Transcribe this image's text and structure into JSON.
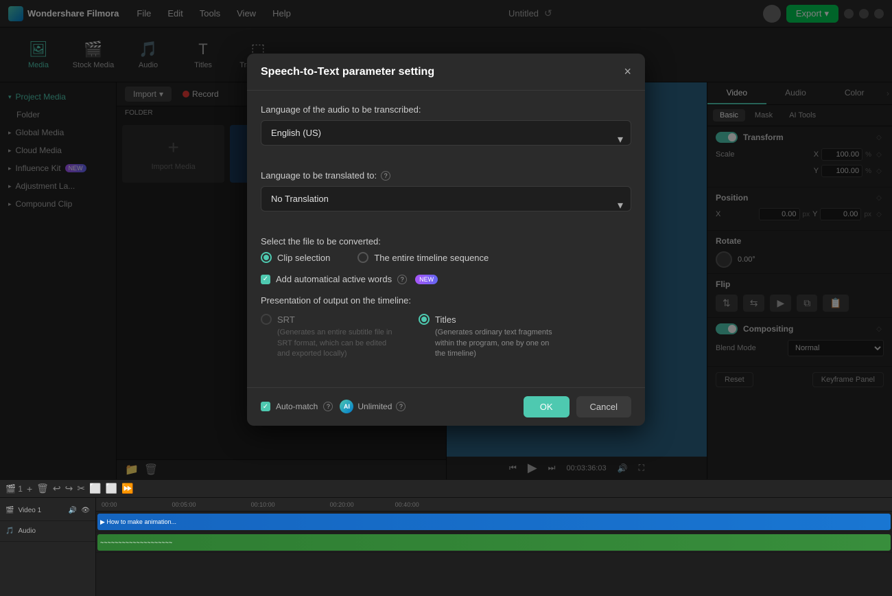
{
  "app": {
    "name": "Wondershare Filmora",
    "title": "Untitled"
  },
  "menu": [
    "File",
    "Edit",
    "Tools",
    "View",
    "Help"
  ],
  "toolbar": {
    "tabs": [
      "Media",
      "Stock Media",
      "Audio",
      "Titles",
      "Transitions"
    ]
  },
  "export_btn": "Export",
  "sidebar": {
    "items": [
      {
        "label": "Project Media",
        "active": true
      },
      {
        "label": "Folder"
      },
      {
        "label": "Global Media"
      },
      {
        "label": "Cloud Media"
      },
      {
        "label": "Influence Kit",
        "badge": "NEW"
      },
      {
        "label": "Adjustment La..."
      },
      {
        "label": "Compound Clip"
      }
    ]
  },
  "media_toolbar": {
    "import_label": "Import",
    "record_label": "Record"
  },
  "folder_label": "FOLDER",
  "right_panel": {
    "tabs": [
      "Video",
      "Audio",
      "Color"
    ],
    "subtabs": [
      "Basic",
      "Mask",
      "AI Tools"
    ],
    "transform_label": "Transform",
    "scale_label": "Scale",
    "x_label": "X",
    "y_label": "Y",
    "x_value": "100.00",
    "y_value": "100.00",
    "percent": "%",
    "position_label": "Position",
    "pos_x_label": "X",
    "pos_x_value": "0.00",
    "pos_y_label": "Y",
    "pos_y_value": "0.00",
    "px": "px",
    "rotate_label": "Rotate",
    "rotate_value": "0.00°",
    "flip_label": "Flip",
    "compositing_label": "Compositing",
    "blend_mode_label": "Blend Mode",
    "blend_mode_value": "Normal",
    "reset_label": "Reset",
    "keyframe_label": "Keyframe Panel"
  },
  "timeline": {
    "time_display": "00:03:36:03",
    "track1_label": "Video 1",
    "clip_title": "How to make animation...",
    "duration": "00:40:00"
  },
  "dialog": {
    "title": "Speech-to-Text parameter setting",
    "close_icon": "×",
    "audio_lang_label": "Language of the audio to be transcribed:",
    "audio_lang_value": "English (US)",
    "translate_label": "Language to be translated to:",
    "translate_value": "No Translation",
    "convert_label": "Select the file to be converted:",
    "clip_selection": "Clip selection",
    "entire_timeline": "The entire timeline sequence",
    "add_words_label": "Add automatical active words",
    "new_badge": "NEW",
    "output_label": "Presentation of output on the timeline:",
    "srt_label": "SRT",
    "srt_desc": "(Generates an entire subtitle file in SRT format, which can be edited and exported locally)",
    "titles_label": "Titles",
    "titles_desc": "(Generates ordinary text fragments within the program, one by one on the timeline)",
    "unlimited_label": "Unlimited",
    "ok_label": "OK",
    "cancel_label": "Cancel",
    "automatch_label": "Auto-match"
  }
}
